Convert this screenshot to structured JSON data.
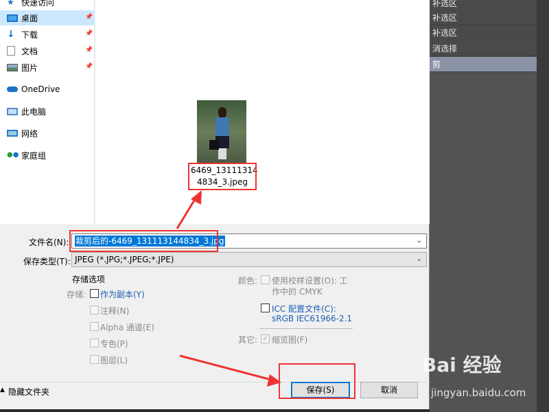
{
  "ps_panel": {
    "items": [
      {
        "label": "补选区"
      },
      {
        "label": "补选区"
      },
      {
        "label": "补选区"
      },
      {
        "label": "消选择"
      },
      {
        "label": "剪"
      }
    ]
  },
  "nav": {
    "quick_access": "快速访问",
    "items": [
      {
        "label": "桌面"
      },
      {
        "label": "下载"
      },
      {
        "label": "文档"
      },
      {
        "label": "图片"
      },
      {
        "label": "OneDrive"
      },
      {
        "label": "此电脑"
      },
      {
        "label": "网络"
      },
      {
        "label": "家庭组"
      }
    ]
  },
  "file": {
    "name_line1": "6469_13111314",
    "name_line2": "4834_3.jpeg"
  },
  "form": {
    "filename_label": "文件名(N):",
    "filename_value": "裁剪后的-6469_131113144834_3.jpg",
    "filetype_label": "保存类型(T):",
    "filetype_value": "JPEG (*.JPG;*.JPEG;*.JPE)"
  },
  "options": {
    "title": "存储选项",
    "storage_label": "存储:",
    "as_copy": "作为副本(Y)",
    "notes": "注释(N)",
    "alpha": "Alpha 通道(E)",
    "spot": "专色(P)",
    "layers": "图层(L)",
    "color_label": "颜色:",
    "proof_line1": "使用校样设置(O):  工",
    "proof_line2": "作中的 CMYK",
    "icc_line1": "ICC 配置文件(C):",
    "icc_line2": "sRGB IEC61966-2.1",
    "other_label": "其它:",
    "thumbnail": "缩览图(F)"
  },
  "footer": {
    "hide_folders": "隐藏文件夹",
    "save": "保存(S)",
    "cancel": "取消"
  },
  "watermark": {
    "text": "Bai 经验",
    "sub": "jingyan.baidu.com"
  },
  "colors": {
    "selection": "#0078d7",
    "annotation_red": "#e33333",
    "nav_selected": "#cce8ff"
  }
}
